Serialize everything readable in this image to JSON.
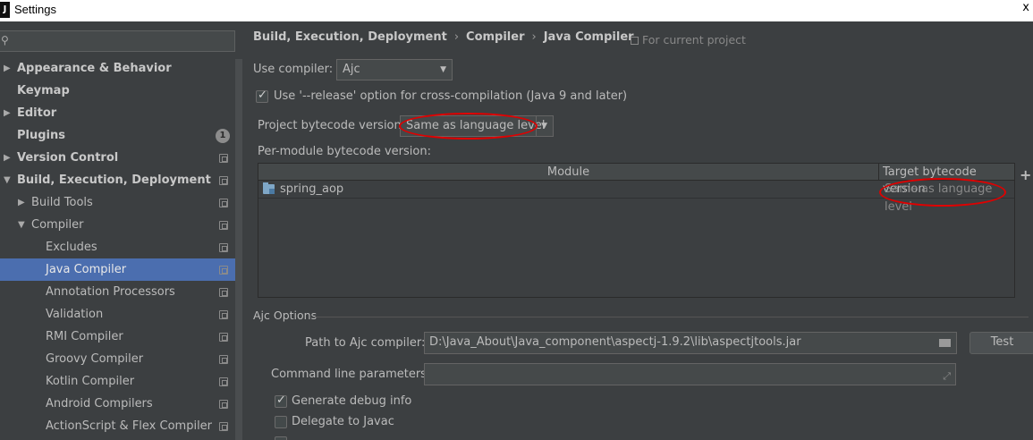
{
  "window": {
    "title": "Settings",
    "app_icon": "J",
    "close_glyph": "x"
  },
  "sidebar": {
    "search_placeholder": "",
    "items": [
      {
        "label": "Appearance & Behavior",
        "bold": true,
        "arrow": "▶"
      },
      {
        "label": "Keymap",
        "bold": true
      },
      {
        "label": "Editor",
        "bold": true,
        "arrow": "▶"
      },
      {
        "label": "Plugins",
        "bold": true,
        "badge": "1"
      },
      {
        "label": "Version Control",
        "bold": true,
        "arrow": "▶"
      },
      {
        "label": "Build, Execution, Deployment",
        "bold": true,
        "arrow": "▼"
      },
      {
        "label": "Build Tools",
        "arrow": "▶"
      },
      {
        "label": "Compiler",
        "arrow": "▼"
      },
      {
        "label": "Excludes"
      },
      {
        "label": "Java Compiler",
        "selected": true
      },
      {
        "label": "Annotation Processors"
      },
      {
        "label": "Validation"
      },
      {
        "label": "RMI Compiler"
      },
      {
        "label": "Groovy Compiler"
      },
      {
        "label": "Kotlin Compiler"
      },
      {
        "label": "Android Compilers"
      },
      {
        "label": "ActionScript & Flex Compiler"
      }
    ]
  },
  "breadcrumb": {
    "parts": [
      "Build, Execution, Deployment",
      "Compiler",
      "Java Compiler"
    ],
    "separator": "›",
    "scope_note": "For current project"
  },
  "compiler": {
    "use_compiler_label": "Use compiler:",
    "use_compiler_value": "Ajc",
    "release_option_label": "Use '--release' option for cross-compilation (Java 9 and later)",
    "release_option_checked": true,
    "bytecode_label": "Project bytecode version:",
    "bytecode_value": "Same as language level",
    "per_module_label": "Per-module bytecode version:"
  },
  "module_table": {
    "columns": [
      "Module",
      "Target bytecode version"
    ],
    "rows": [
      {
        "module": "spring_aop",
        "target": "Same as language level"
      }
    ],
    "add_glyph": "+"
  },
  "ajc": {
    "section_title": "Ajc Options",
    "path_label": "Path to Ajc compiler:",
    "path_value": "D:\\Java_About\\Java_component\\aspectj-1.9.2\\lib\\aspectjtools.jar",
    "test_button": "Test",
    "cmd_label": "Command line parameters:",
    "cmd_value": "",
    "generate_debug_label": "Generate debug info",
    "generate_debug_checked": true,
    "delegate_label": "Delegate to Javac",
    "delegate_checked": false
  },
  "colors": {
    "background": "#3c3f41",
    "selection": "#4b6eaf",
    "annotation": "#e00000"
  }
}
